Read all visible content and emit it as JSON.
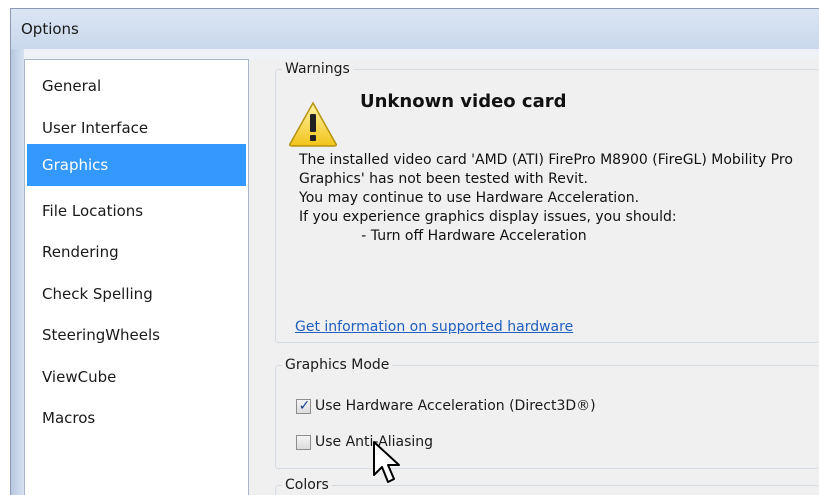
{
  "window": {
    "title": "Options"
  },
  "sidebar": {
    "items": [
      {
        "label": "General"
      },
      {
        "label": "User Interface"
      },
      {
        "label": "Graphics",
        "selected": true
      },
      {
        "label": "File Locations"
      },
      {
        "label": "Rendering"
      },
      {
        "label": "Check Spelling"
      },
      {
        "label": "SteeringWheels"
      },
      {
        "label": "ViewCube"
      },
      {
        "label": "Macros"
      }
    ]
  },
  "warnings": {
    "legend": "Warnings",
    "icon": "warning-triangle-icon",
    "title": "Unknown video card",
    "body": "The installed video card 'AMD (ATI) FirePro M8900 (FireGL) Mobility Pro\nGraphics' has not been tested with Revit.\nYou may continue to use Hardware Acceleration.\nIf you experience graphics display issues, you should:\n              - Turn off Hardware Acceleration",
    "link": "Get information on supported hardware"
  },
  "graphics_mode": {
    "legend": "Graphics Mode",
    "hardware_acceleration": {
      "label": "Use Hardware Acceleration (Direct3D®)",
      "checked": true
    },
    "anti_aliasing": {
      "label": "Use Anti-Aliasing",
      "checked": false
    }
  },
  "colors": {
    "legend": "Colors"
  },
  "theme": {
    "selected_bg": "#3399ff",
    "link_color": "#1f5fbf"
  }
}
